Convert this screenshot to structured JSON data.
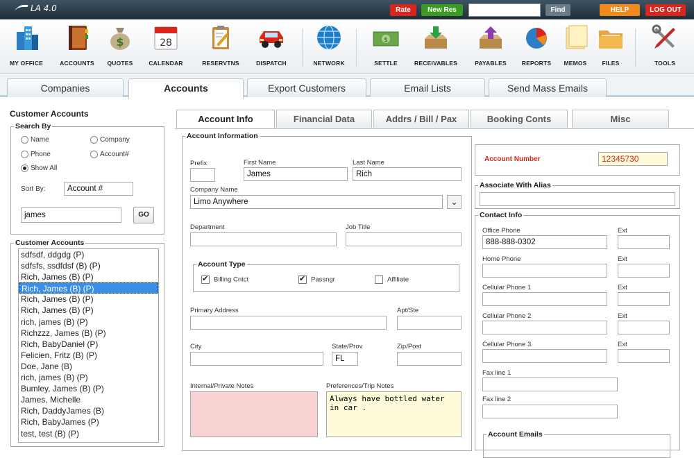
{
  "app": {
    "title": "LA 4.0"
  },
  "topbar": {
    "rate": "Rate",
    "new_res": "New Res",
    "search_value": "",
    "find": "Find",
    "help": "HELP",
    "logout": "LOG OUT"
  },
  "toolbar": [
    {
      "label": "MY OFFICE",
      "icon": "building-icon"
    },
    {
      "label": "ACCOUNTS",
      "icon": "address-book-icon"
    },
    {
      "label": "QUOTES",
      "icon": "money-bag-icon"
    },
    {
      "label": "CALENDAR",
      "icon": "calendar-icon",
      "day": "28"
    },
    {
      "label": "RESERVTNS",
      "icon": "clipboard-icon"
    },
    {
      "label": "DISPATCH",
      "icon": "car-icon"
    },
    {
      "label": "NETWORK",
      "icon": "globe-icon"
    },
    {
      "label": "SETTLE",
      "icon": "cash-icon"
    },
    {
      "label": "RECEIVABLES",
      "icon": "inbox-in-icon"
    },
    {
      "label": "PAYABLES",
      "icon": "inbox-out-icon"
    },
    {
      "label": "REPORTS",
      "icon": "pie-chart-icon"
    },
    {
      "label": "MEMOS",
      "icon": "memo-icon"
    },
    {
      "label": "FILES",
      "icon": "folder-icon"
    },
    {
      "label": "TOOLS",
      "icon": "tools-icon"
    }
  ],
  "main_tabs": [
    "Companies",
    "Accounts",
    "Export Customers",
    "Email Lists",
    "Send Mass Emails"
  ],
  "left": {
    "title": "Customer Accounts",
    "search_by": "Search By",
    "radios": [
      "Name",
      "Company",
      "Phone",
      "Account#",
      "Show All"
    ],
    "sort_by_label": "Sort By:",
    "sort_by_value": "Account #",
    "search_value": "james",
    "go": "GO",
    "list_title": "Customer Accounts",
    "accounts": [
      "sdfsdf, ddgdg (P)",
      "sdfsfs, ssdfdsf (B) (P)",
      "Rich, James (B) (P)",
      "Rich, James (B) (P)",
      "Rich, James (B) (P)",
      "Rich, James (B) (P)",
      "rich, james (B) (P)",
      "Richzzz, James (B) (P)",
      "Rich, BabyDaniel (P)",
      "Felicien, Fritz (B) (P)",
      "Doe, Jane (B)",
      "rich, james (B) (P)",
      "Bumley, James (B) (P)",
      "James, Michelle",
      "Rich, DaddyJames (B)",
      "Rich, BabyJames (P)",
      "test, test (B) (P)"
    ]
  },
  "detail_tabs": [
    "Account Info",
    "Financial Data",
    "Addrs / Bill / Pax",
    "Booking Conts",
    "Misc"
  ],
  "account_info": {
    "legend": "Account Information",
    "prefix_label": "Prefix",
    "prefix": "",
    "first_label": "First Name",
    "first": "James",
    "last_label": "Last Name",
    "last": "Rich",
    "company_label": "Company Name",
    "company": "Limo Anywhere",
    "dept_label": "Department",
    "dept": "",
    "job_label": "Job Title",
    "job": "",
    "type_legend": "Account Type",
    "types": [
      {
        "label": "Billing Cntct",
        "checked": true
      },
      {
        "label": "Passngr",
        "checked": true
      },
      {
        "label": "Affiliate",
        "checked": false
      }
    ],
    "addr_label": "Primary Address",
    "addr": "",
    "apt_label": "Apt/Ste",
    "apt": "",
    "city_label": "City",
    "city": "",
    "state_label": "State/Prov",
    "state": "FL",
    "zip_label": "Zip/Post",
    "zip": "",
    "notes_label": "Internal/Private Notes",
    "notes": "",
    "prefs_label": "Preferences/Trip Notes",
    "prefs": "Always have bottled water in car ."
  },
  "account_number": {
    "label": "Account Number",
    "value": "12345730"
  },
  "alias": {
    "legend": "Associate With Alias",
    "value": ""
  },
  "contact": {
    "legend": "Contact Info",
    "ext_label": "Ext",
    "phones": [
      {
        "label": "Office Phone",
        "value": "888-888-0302"
      },
      {
        "label": "Home Phone",
        "value": ""
      },
      {
        "label": "Cellular Phone 1",
        "value": ""
      },
      {
        "label": "Cellular Phone 2",
        "value": ""
      },
      {
        "label": "Cellular Phone 3",
        "value": ""
      }
    ],
    "fax1": "Fax line 1",
    "fax2": "Fax line 2",
    "emails_legend": "Account Emails"
  },
  "colors": {
    "accent": "#3a8ee6",
    "brand_dark": "#1e2d38",
    "notes_bg": "#f9d3d3",
    "prefs_bg": "#fdfbd9",
    "acct_num": "#d9261c"
  }
}
